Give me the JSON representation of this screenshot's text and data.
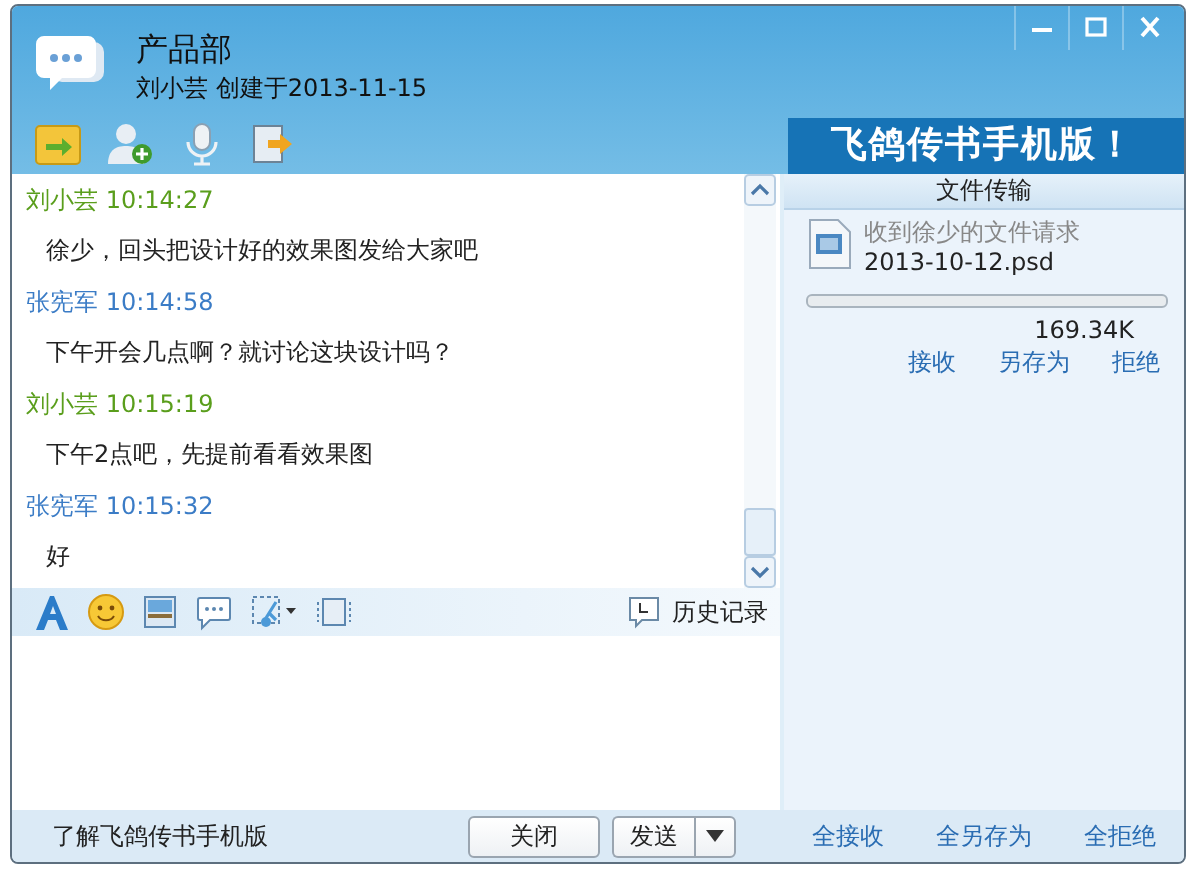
{
  "window": {
    "title": "产品部",
    "subtitle": "刘小芸 创建于2013-11-15"
  },
  "banner": "飞鸽传书手机版！",
  "messages": [
    {
      "sender": "刘小芸",
      "time": "10:14:27",
      "color": "#5a9e1c",
      "text": "徐少，回头把设计好的效果图发给大家吧"
    },
    {
      "sender": "张宪军",
      "time": "10:14:58",
      "color": "#3b7cc6",
      "text": "下午开会几点啊？就讨论这块设计吗？"
    },
    {
      "sender": "刘小芸",
      "time": "10:15:19",
      "color": "#5a9e1c",
      "text": "下午2点吧，先提前看看效果图"
    },
    {
      "sender": "张宪军",
      "time": "10:15:32",
      "color": "#3b7cc6",
      "text": "好"
    }
  ],
  "history_button": "历史记录",
  "file_transfer": {
    "title": "文件传输",
    "request": "收到徐少的文件请求",
    "file_name": "2013-10-12.psd",
    "level": 0,
    "size": "169.34K",
    "actions": [
      "接收",
      "另存为",
      "拒绝"
    ]
  },
  "footer": {
    "link": "了解飞鸽传书手机版",
    "buttons": [
      "关闭",
      "发送"
    ],
    "bulk_actions": [
      "全接收",
      "全另存为",
      "全拒绝"
    ]
  }
}
